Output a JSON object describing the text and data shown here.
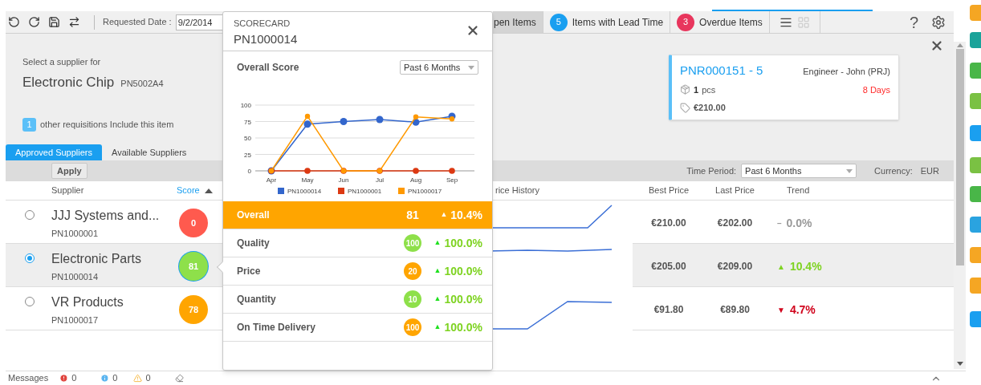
{
  "toolbar": {
    "date_label": "Requested Date :",
    "date": "9/2/2014",
    "help": "?"
  },
  "top_tabs": [
    {
      "label": "pen Items",
      "selected": true
    },
    {
      "badge": "5",
      "color": "#1a9ff0",
      "label": "Items with Lead Time",
      "selected": false
    },
    {
      "badge": "3",
      "color": "#e8365d",
      "label": "Overdue Items",
      "selected": false
    }
  ],
  "view_toggle": [
    {
      "kind": "list",
      "selected": true
    },
    {
      "kind": "grid",
      "selected": false
    }
  ],
  "header": {
    "prompt": "Select a supplier for",
    "item_name": "Electronic Chip",
    "item_code": "PN5002A4",
    "other_count": "1",
    "other_text": "other requisitions Include this item"
  },
  "requisition_card": {
    "id": "PNR000151 - 5",
    "requester": "Engineer - John (PRJ)",
    "quantity": "1",
    "unit": "pcs",
    "due": "8 Days",
    "price": "€210.00"
  },
  "supplier_tabs": [
    {
      "label": "Approved Suppliers",
      "selected": true
    },
    {
      "label": "Available Suppliers",
      "selected": false
    }
  ],
  "filter_bar": {
    "apply": "Apply",
    "time_period_label": "Time Period:",
    "time_period": "Past 6 Months",
    "currency_label": "Currency:",
    "currency": "EUR"
  },
  "table": {
    "columns": [
      {
        "label": "Supplier",
        "sorted": false
      },
      {
        "label": "Score",
        "sorted": true
      },
      {
        "label": "rice History",
        "sorted": false
      },
      {
        "label": "Best Price",
        "sorted": false
      },
      {
        "label": "Last Price",
        "sorted": false
      },
      {
        "label": "Trend",
        "sorted": false
      }
    ],
    "rows": [
      {
        "name": "JJJ Systems and...",
        "code": "PN1000001",
        "score": "0",
        "color": "#ff5a4e",
        "selected": false,
        "best_price": "€210.00",
        "last_price": "€202.00",
        "trend": {
          "arrow": "–",
          "value": "0.0%",
          "color": "#999999"
        }
      },
      {
        "name": "Electronic Parts",
        "code": "PN1000014",
        "score": "81",
        "color": "#8ee04a",
        "selected": true,
        "best_price": "€205.00",
        "last_price": "€209.00",
        "trend": {
          "arrow": "▲",
          "value": "10.4%",
          "color": "#7ed321"
        }
      },
      {
        "name": "VR Products",
        "code": "PN1000017",
        "score": "78",
        "color": "#ffa500",
        "selected": false,
        "best_price": "€91.80",
        "last_price": "€89.80",
        "trend": {
          "arrow": "▼",
          "value": "4.7%",
          "color": "#d0021b"
        }
      }
    ]
  },
  "scorecard": {
    "heading": "SCORECARD",
    "supplier_code": "PN1000014",
    "chart_title": "Overall Score",
    "period": "Past 6 Months",
    "chart_data": {
      "type": "line",
      "categories": [
        "Apr",
        "May",
        "Jun",
        "Jul",
        "Aug",
        "Sep"
      ],
      "yticks": [
        0,
        25,
        50,
        75,
        100
      ],
      "ylim": [
        0,
        100
      ],
      "grid": true,
      "legend": true,
      "series": [
        {
          "name": "PN1000014",
          "color": "#3366cc",
          "marker": "circle",
          "values": [
            0,
            71,
            75,
            78,
            74,
            83
          ]
        },
        {
          "name": "PN1000001",
          "color": "#dc3912",
          "marker": "circle",
          "values": [
            0,
            0,
            0,
            0,
            0,
            0
          ]
        },
        {
          "name": "PN1000017",
          "color": "#ff9900",
          "marker": "circle",
          "values": [
            0,
            83,
            0,
            0,
            82,
            79
          ]
        }
      ]
    },
    "scores": [
      {
        "kind": "total",
        "label": "Overall",
        "value": "81",
        "arrow": "▲",
        "change": "10.4%"
      },
      {
        "kind": "metric",
        "label": "Quality",
        "value": "100",
        "color": "#8ee04a",
        "arrow": "▲",
        "change": "100.0%"
      },
      {
        "kind": "metric",
        "label": "Price",
        "value": "20",
        "color": "#ffa500",
        "arrow": "▲",
        "change": "100.0%"
      },
      {
        "kind": "metric",
        "label": "Quantity",
        "value": "10",
        "color": "#8ee04a",
        "arrow": "▲",
        "change": "100.0%"
      },
      {
        "kind": "metric",
        "label": "On Time Delivery",
        "value": "100",
        "color": "#ffa500",
        "arrow": "▲",
        "change": "100.0%"
      }
    ]
  },
  "status_bar": {
    "label": "Messages",
    "errors": "0",
    "infos": "0",
    "warnings": "0"
  }
}
